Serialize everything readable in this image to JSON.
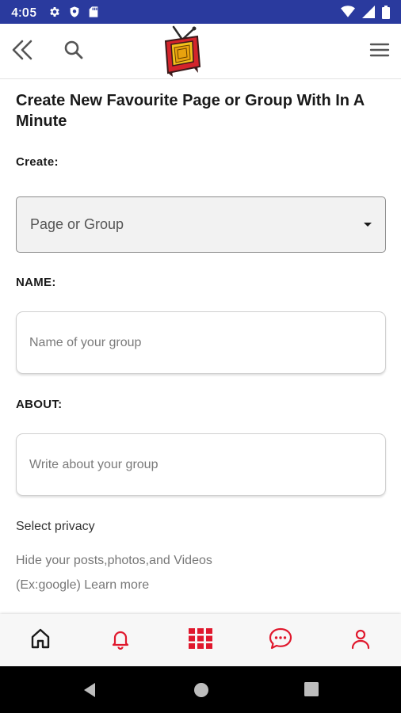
{
  "status_bar": {
    "time": "4:05",
    "left_icons": [
      "gear-icon",
      "shield-icon",
      "sd-card-icon"
    ],
    "right_icons": [
      "wifi-icon",
      "signal-icon",
      "battery-icon"
    ]
  },
  "app_bar": {
    "back_icon": "double-chevron-left-icon",
    "search_icon": "search-icon",
    "logo": "tv-logo",
    "menu_icon": "hamburger-menu-icon"
  },
  "form": {
    "title": "Create New Favourite Page or Group With In A Minute",
    "create_label": "Create:",
    "create_select_value": "Page or Group",
    "name_label": "NAME:",
    "name_placeholder": "Name of your group",
    "about_label": "ABOUT:",
    "about_placeholder": "Write about your group",
    "privacy_title": "Select privacy",
    "privacy_description": "Hide your posts,photos,and Videos",
    "privacy_example": "(Ex:google)",
    "learn_more": "Learn more"
  },
  "bottom_nav": {
    "items": [
      "home-icon",
      "bell-icon",
      "grid-icon",
      "chat-icon",
      "profile-icon"
    ]
  },
  "colors": {
    "status_bar": "#2a3a9e",
    "accent": "#e0182d",
    "text_primary": "#1a1a1a",
    "text_secondary": "#777777"
  }
}
